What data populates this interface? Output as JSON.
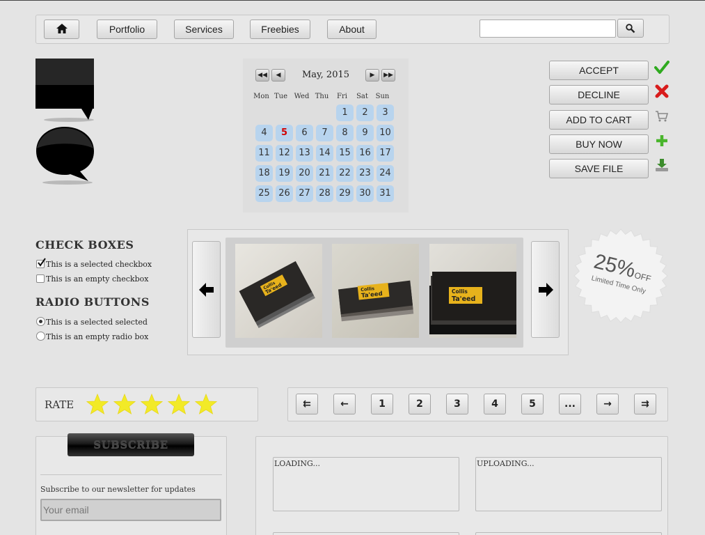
{
  "nav": {
    "home_icon": "home-icon",
    "items": [
      {
        "label": "Portfolio"
      },
      {
        "label": "Services"
      },
      {
        "label": "Freebies"
      },
      {
        "label": "About"
      }
    ],
    "search": {
      "placeholder": "",
      "value": "",
      "icon": "search-icon"
    }
  },
  "calendar": {
    "title": "May, 2015",
    "weekdays": [
      "Mon",
      "Tue",
      "Wed",
      "Thu",
      "Fri",
      "Sat",
      "Sun"
    ],
    "today": "5",
    "days": [
      "1",
      "2",
      "3",
      "4",
      "5",
      "6",
      "7",
      "8",
      "9",
      "10",
      "11",
      "12",
      "13",
      "14",
      "15",
      "16",
      "17",
      "18",
      "19",
      "20",
      "21",
      "22",
      "23",
      "24",
      "25",
      "26",
      "27",
      "28",
      "29",
      "30",
      "31"
    ],
    "nav_icons": [
      "prev-year-icon",
      "prev-month-icon",
      "next-month-icon",
      "next-year-icon"
    ]
  },
  "actions": [
    {
      "label": "ACCEPT",
      "icon": "checkmark-icon",
      "color": "#2faa1f"
    },
    {
      "label": "DECLINE",
      "icon": "cross-icon",
      "color": "#d81c1c"
    },
    {
      "label": "ADD TO CART",
      "icon": "cart-icon",
      "color": "#888888"
    },
    {
      "label": "BUY NOW",
      "icon": "plus-icon",
      "color": "#49b52c"
    },
    {
      "label": "SAVE FILE",
      "icon": "download-icon",
      "color": "#3c8c2c"
    }
  ],
  "form": {
    "checkbox_heading": "CHECK BOXES",
    "checkbox_selected": "This is a selected checkbox",
    "checkbox_empty": "This is an empty checkbox",
    "radio_heading": "RADIO BUTTONS",
    "radio_selected": "This is a selected selected",
    "radio_empty": "This is an empty radio box"
  },
  "slider": {
    "cards": [
      {
        "line1": "Collis",
        "line2": "Ta'eed"
      },
      {
        "line1": "Collis",
        "line2": "Ta'eed"
      },
      {
        "line1": "Collis",
        "line2": "Ta'eed"
      }
    ]
  },
  "badge": {
    "percent": "25%",
    "off": "OFF",
    "subtitle": "Limited Time Only"
  },
  "rating": {
    "label": "RATE",
    "stars_filled": 5,
    "stars_total": 5
  },
  "pagination": {
    "first": "⇇",
    "prev": "←",
    "pages": [
      "1",
      "2",
      "3",
      "4",
      "5",
      "..."
    ],
    "next": "→",
    "last": "⇉"
  },
  "subscribe": {
    "button": "SUBSCRIBE",
    "text": "Subscribe to our newsletter for updates",
    "placeholder": "Your email"
  },
  "progress": {
    "loading": "LOADING...",
    "uploading": "UPLOADING..."
  }
}
